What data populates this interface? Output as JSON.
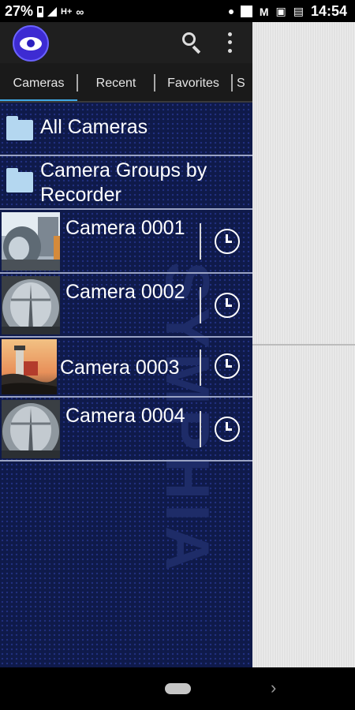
{
  "status_bar": {
    "battery": "27%",
    "network": "H+",
    "time": "14:54"
  },
  "toolbar": {
    "logo_icon": "eye-icon",
    "search_icon": "search-icon",
    "more_icon": "more-vert-icon"
  },
  "tabs": [
    {
      "label": "Cameras",
      "active": true
    },
    {
      "label": "Recent",
      "active": false
    },
    {
      "label": "Favorites",
      "active": false
    },
    {
      "label": "S",
      "active": false
    }
  ],
  "list": {
    "watermark": "SYMPHIA",
    "folders": [
      {
        "label": "All Cameras"
      },
      {
        "label": "Camera Groups by Recorder"
      }
    ],
    "cameras": [
      {
        "label": "Camera 0001",
        "icon": "clock-icon"
      },
      {
        "label": "Camera 0002",
        "icon": "clock-icon"
      },
      {
        "label": "Camera 0003",
        "icon": "clock-icon"
      },
      {
        "label": "Camera 0004",
        "icon": "clock-icon"
      }
    ]
  },
  "colors": {
    "accent": "#3fa9e6",
    "list_bg": "#0f1a4a",
    "logo": "#3d2bd2"
  }
}
